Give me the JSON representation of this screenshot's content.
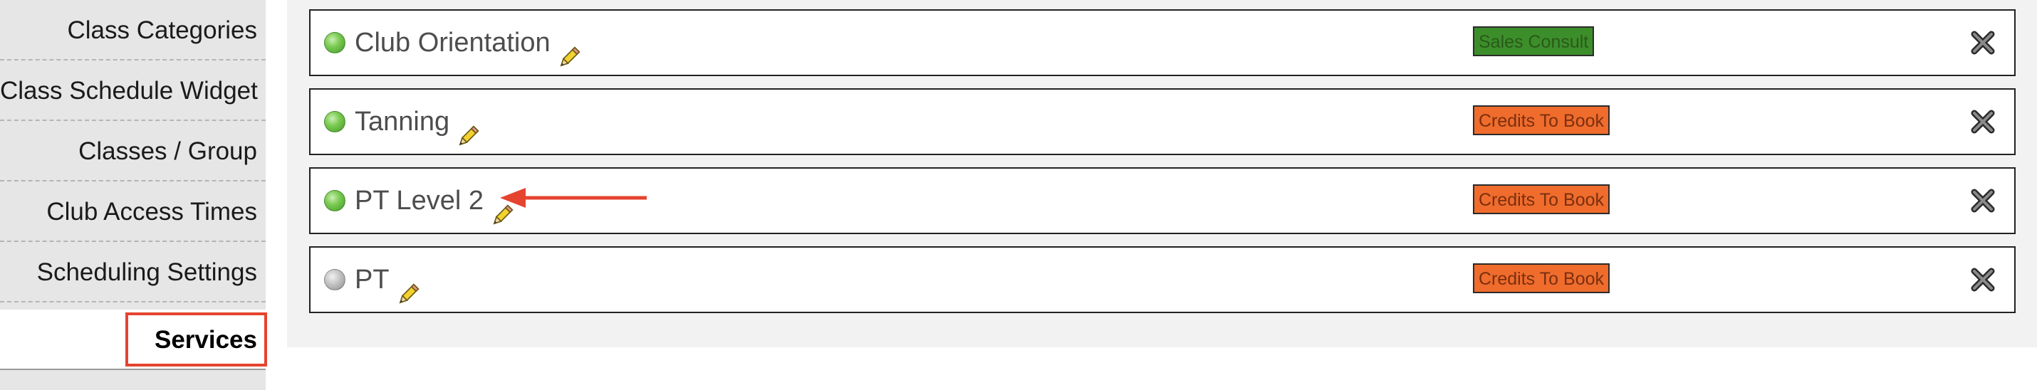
{
  "sidebar": {
    "items": [
      {
        "label": "Class Categories"
      },
      {
        "label": "Class Schedule Widget"
      },
      {
        "label": "Classes / Group"
      },
      {
        "label": "Club Access Times"
      },
      {
        "label": "Scheduling Settings"
      },
      {
        "label": "Services",
        "active": true
      }
    ]
  },
  "services": [
    {
      "name": "Club Orientation",
      "status": "active",
      "tag": "Sales Consult",
      "tag_color": "#3c8e2a"
    },
    {
      "name": "Tanning",
      "status": "active",
      "tag": "Credits To Book",
      "tag_color": "#ef6c2c"
    },
    {
      "name": "PT Level 2",
      "status": "active",
      "tag": "Credits To Book",
      "tag_color": "#ef6c2c"
    },
    {
      "name": "PT",
      "status": "inactive",
      "tag": "Credits To Book",
      "tag_color": "#ef6c2c"
    }
  ],
  "colors": {
    "annotation": "#e5442f",
    "status_active": "#5fb43a",
    "status_inactive": "#b0b0b0"
  },
  "icons": {
    "edit": "pencil-icon",
    "delete": "close-icon",
    "annotation": "arrow-left-icon"
  }
}
